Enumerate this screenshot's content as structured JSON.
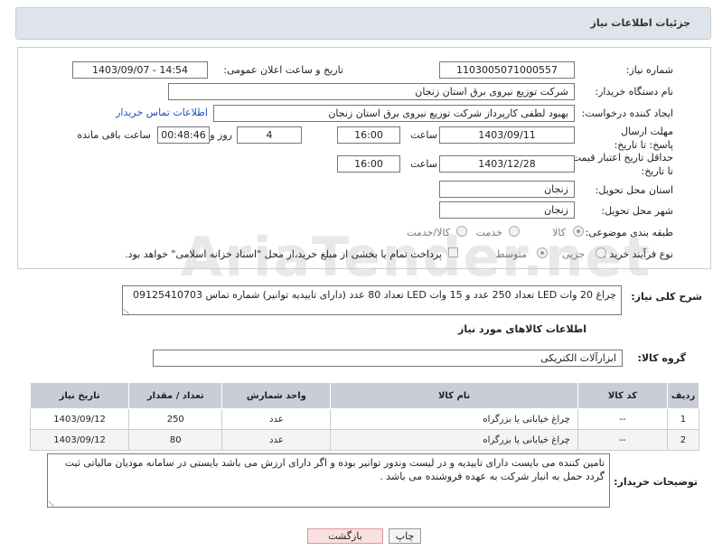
{
  "header": {
    "title": "جزئیات اطلاعات نیاز"
  },
  "fields": {
    "need_number_label": "شماره نیاز:",
    "need_number": "1103005071000557",
    "announce_label": "تاریخ و ساعت اعلان عمومی:",
    "announce_value": "1403/09/07 - 14:54",
    "buyer_org_label": "نام دستگاه خریدار:",
    "buyer_org": "شرکت توزیع نیروی برق استان زنجان",
    "creator_label": "ایجاد کننده درخواست:",
    "creator": "بهبود لطفی کارپرداز شرکت توزیع نیروی برق استان زنجان",
    "contact_link": "اطلاعات تماس خریدار",
    "deadline_label": "مهلت ارسال پاسخ: تا تاریخ:",
    "deadline_date": "1403/09/11",
    "time_label": "ساعت",
    "deadline_time": "16:00",
    "days_value": "4",
    "days_label": "روز و",
    "remaining_time": "00:48:46",
    "remaining_label": "ساعت باقی مانده",
    "validity_label": "حداقل تاریخ اعتبار قیمت: تا تاریخ:",
    "validity_date": "1403/12/28",
    "validity_time": "16:00",
    "province_label": "استان محل تحویل:",
    "province": "زنجان",
    "city_label": "شهر محل تحویل:",
    "city": "زنجان",
    "category_label": "طبقه بندی موضوعی:",
    "cat_goods": "کالا",
    "cat_service": "خدمت",
    "cat_goods_service": "کالا/خدمت",
    "process_label": "نوع فرآیند خرید :",
    "proc_minor": "جزیی",
    "proc_medium": "متوسط",
    "payment_note": "پرداخت تمام یا بخشی از مبلغ خرید،از محل \"اسناد خزانه اسلامی\" خواهد بود."
  },
  "description": {
    "label": "شرح کلی نیاز:",
    "text": "چراغ 20 وات LED تعداد 250 عدد و 15 وات LED تعداد 80 عدد (دارای تاییدیه توانیر) شماره تماس 09125410703"
  },
  "goods": {
    "section_title": "اطلاعات کالاهای مورد نیاز",
    "group_label": "گروه کالا:",
    "group_value": "ابزارآلات الکتریکی",
    "columns": [
      "ردیف",
      "کد کالا",
      "نام کالا",
      "واحد شمارش",
      "تعداد / مقدار",
      "تاریخ نیاز"
    ],
    "rows": [
      [
        "1",
        "--",
        "چراغ خیابانی یا بزرگراه",
        "عدد",
        "250",
        "1403/09/12"
      ],
      [
        "2",
        "--",
        "چراغ خیابانی یا بزرگراه",
        "عدد",
        "80",
        "1403/09/12"
      ]
    ]
  },
  "notes": {
    "label": "توضیحات خریدار:",
    "text": "تامین کننده می بایست دارای تاییدیه و در لیست وندور توانیر بوده و اگر دارای ارزش می باشد بایستی در سامانه مودیان مالیاتی ثبت گردد حمل به انبار شرکت به عهده فروشنده می باشد ."
  },
  "buttons": {
    "print": "چاپ",
    "back": "بازگشت"
  },
  "watermark": "AriaTender.net"
}
